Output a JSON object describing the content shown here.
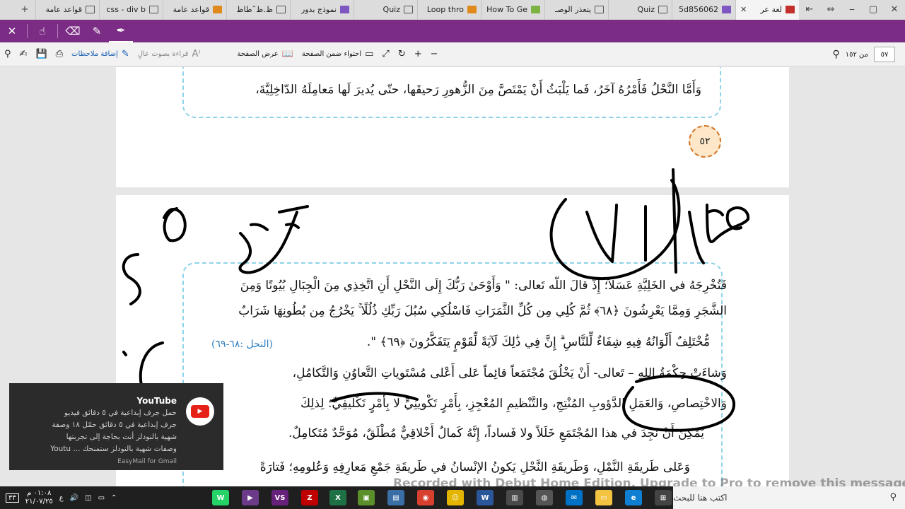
{
  "tabs": [
    {
      "label": "لغة عر",
      "icon": "pdf-icon",
      "active": true
    },
    {
      "label": "5d856062",
      "icon": "image-icon"
    },
    {
      "label": "Quiz",
      "icon": "window-icon"
    },
    {
      "label": "يتعذر الوصـ",
      "icon": "window-icon"
    },
    {
      "label": "How To Ge",
      "icon": "code-icon"
    },
    {
      "label": "Loop thro",
      "icon": "bookmark-icon"
    },
    {
      "label": "Quiz",
      "icon": "window-icon"
    },
    {
      "label": "نموذج بدور",
      "icon": "form-icon"
    },
    {
      "label": "ظ.ظ˜طاظ",
      "icon": "window-icon"
    },
    {
      "label": "قواعد عامة",
      "icon": "bookmark-icon"
    },
    {
      "label": "css - div b",
      "icon": "window-icon"
    },
    {
      "label": "قواعد عامة",
      "icon": "window-icon"
    }
  ],
  "toolbar": {
    "add_notes": "إضافة ملاحظات",
    "read_aloud": "قراءة بصوت عالٍ",
    "page_view": "عرض الصفحة",
    "fit_page": "احتواء ضمن الصفحة",
    "page_current": "٥٧",
    "page_total": "من ١٥٢"
  },
  "page1": {
    "line_top": "وَأَمَّا النَّحْلُ فَأَمْرُهُ آخَرُ، فَما يَلْبَثُ أَنْ يَمْتَصَّ مِنَ الزُّهورِ رَحيقَها، حتّى يُديرَ لَها مَعامِلَهُ الدّاخِلِيَّةَ،",
    "page_number": "٥٢"
  },
  "page2": {
    "lines": [
      "فَتُخْرِجَهُ في الخَلِيَّةِ عَسَلاً؛ إِذْ قالَ اللّه تَعالى: \" وَأَوْحَىٰ رَبُّكَ إِلَى النَّحْلِ أَنِ اتَّخِذِي مِنَ الْجِبَالِ بُيُوتًا وَمِنَ",
      "الشَّجَرِ وَمِمَّا يَعْرِشُونَ ﴿٦٨﴾ ثُمَّ كُلِي مِن كُلِّ الثَّمَرَاتِ فَاسْلُكِي سُبُلَ رَبِّكِ ذُلُلًا ۚ يَخْرُجُ مِن بُطُونِهَا شَرَابٌ",
      "مُّخْتَلِفٌ أَلْوَانُهُ فِيهِ شِفَاءٌ لِّلنَّاسِ ۗ إِنَّ فِي ذَٰلِكَ لَآيَةً لِّقَوْمٍ يَتَفَكَّرُونَ ﴿٦٩﴾ \".",
      "وَشاءَتْ حِكْمَةُ اللهِ – تَعالى- أَنْ يَخْلُقَ مُجْتَمَعاً قائِماً عَلى أَعْلى مُسْتَوياتِ التَّعاوُنِ وَالتَّكامُلِ،",
      "وَالاخْتِصاصِ، وَالعَمَلِ الدَّؤوبِ المُنْتِجِ، والتَّنْظيمِ المُعْجِزِ، بِأَمْرٍ تَكْوينِيٍّ لا بِأَمْرٍ تَكْليفِيٍّ؛ لِذلِكَ",
      "يُمْكِنُ أَنْ نَجِدَ في هذا المُجْتَمَعِ خَلَلاً ولا فَساداً، إِنَّهُ كَمالٌ أَخْلاقِيٌّ مُطْلَقٌ، مُوَحَّدٌ مُتَكامِلٌ.",
      "وَعَلى طَريقَةِ النَّمْلِ، وَطَريقَةِ النَّحْلِ يَكونُ الإنْسانُ في طَريقَةِ جَمْعِ مَعارِفِهِ وَعُلومِهِ؛ فَتارَةً"
    ],
    "reference": "(النحل :٦٨-٦٩)"
  },
  "notification": {
    "app": "YouTube",
    "lines": [
      "حمل جرف إبداعية في ٥ دقائق فيديو",
      "جرف إبداعية في ٥ دقائق حمّل ١٨ وصفة",
      "شهية بالنودلز أنت بحاجة إلى تجربتها",
      "وصفات شهية بالنودلز ستمنحك ... Youtu"
    ],
    "footer": "EasyMail for Gmail"
  },
  "watermark": "Recorded with Debut Home Edition. Upgrade to Pro to remove this message",
  "taskbar": {
    "search_placeholder": "اكتب هنا للبحث",
    "time": "٠١:٠٨ م",
    "date": "٢١/٠٧/٢٥",
    "lang": "ع",
    "notif_count": "٣٣"
  }
}
